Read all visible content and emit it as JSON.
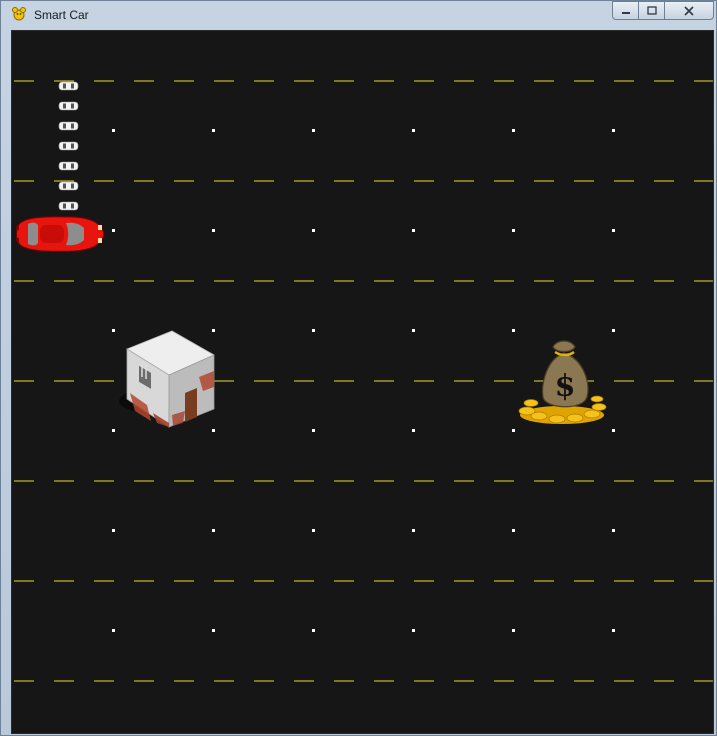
{
  "window": {
    "title": "Smart Car",
    "controls": {
      "minimize": "minimize",
      "maximize": "maximize",
      "close": "close"
    }
  },
  "game": {
    "background_color": "#161616",
    "lane_color": "#e6d92e",
    "marker_color": "#ffffff",
    "player_car": {
      "icon": "red-car-icon",
      "color": "#e8140e",
      "row": 2,
      "col": 0
    },
    "obstacle": {
      "icon": "house-icon",
      "row": 3,
      "col": 1
    },
    "goal": {
      "icon": "money-bag-icon",
      "symbol": "$",
      "row": 3,
      "col": 5
    },
    "remaining_cars": 7
  }
}
